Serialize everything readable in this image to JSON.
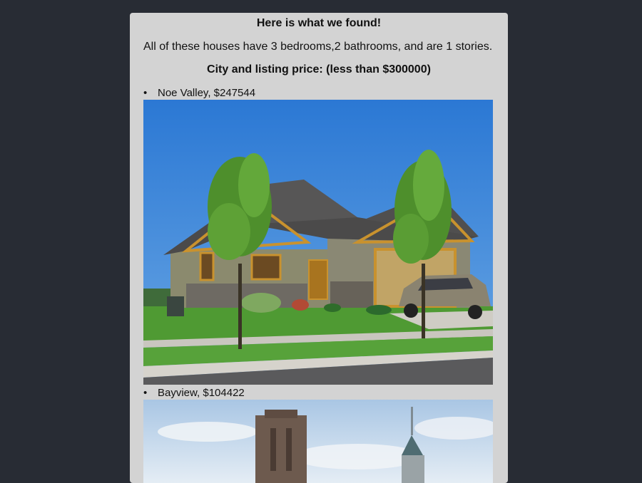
{
  "results": {
    "title": "Here is what we found!",
    "summary": "All of these houses have 3 bedrooms,2 bathrooms, and are 1 stories.",
    "subtitle": "City and listing price: (less than $300000)",
    "listings": [
      {
        "bullet": "•",
        "label": "Noe Valley, $247544",
        "image": "single-story house photo"
      },
      {
        "bullet": "•",
        "label": "Bayview, $104422",
        "image": "city skyline photo"
      }
    ]
  },
  "colors": {
    "page_bg": "#282c34",
    "card_bg": "#d3d3d3",
    "sky_blue": "#2f7fd6"
  }
}
